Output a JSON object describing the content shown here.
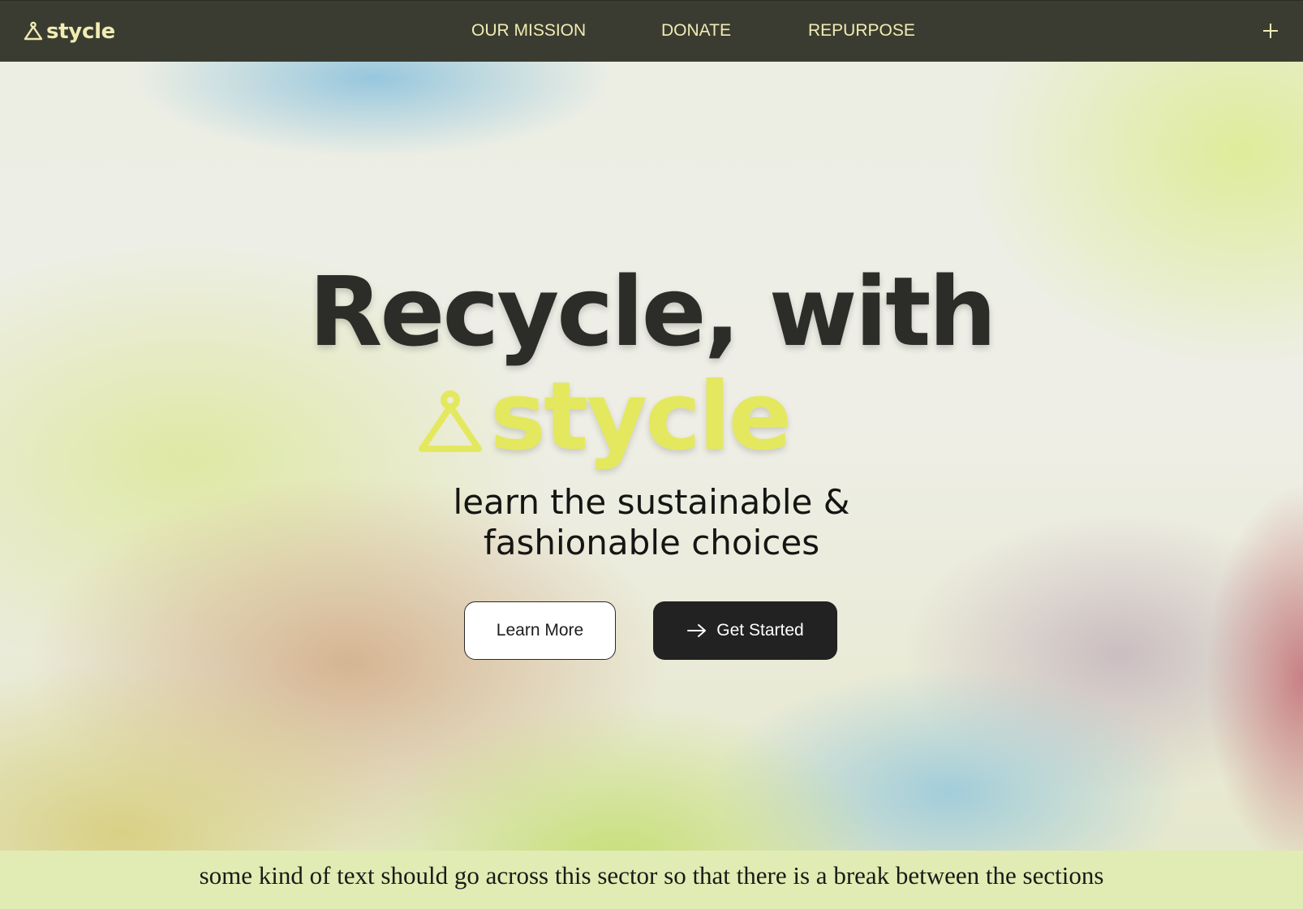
{
  "nav": {
    "brand": "stycle",
    "links": [
      "OUR MISSION",
      "DONATE",
      "REPURPOSE"
    ],
    "plus_icon": "plus-icon"
  },
  "hero": {
    "headline": "Recycle, with",
    "brand": "stycle",
    "subtitle_line1": "learn the sustainable &",
    "subtitle_line2": "fashionable choices",
    "learn_more": "Learn More",
    "get_started": "Get Started"
  },
  "banner": {
    "text": "some kind of text should go across this sector so that there is a break between the sections"
  },
  "colors": {
    "nav_bg": "#3b3c31",
    "nav_text": "#f1ecb3",
    "brand_yellow": "#e4e85f",
    "headline": "#2c2c28",
    "button_dark": "#222222",
    "banner_bg": "#e0ecb3"
  },
  "icons": {
    "logo": "hanger-icon",
    "arrow": "arrow-right-icon"
  }
}
